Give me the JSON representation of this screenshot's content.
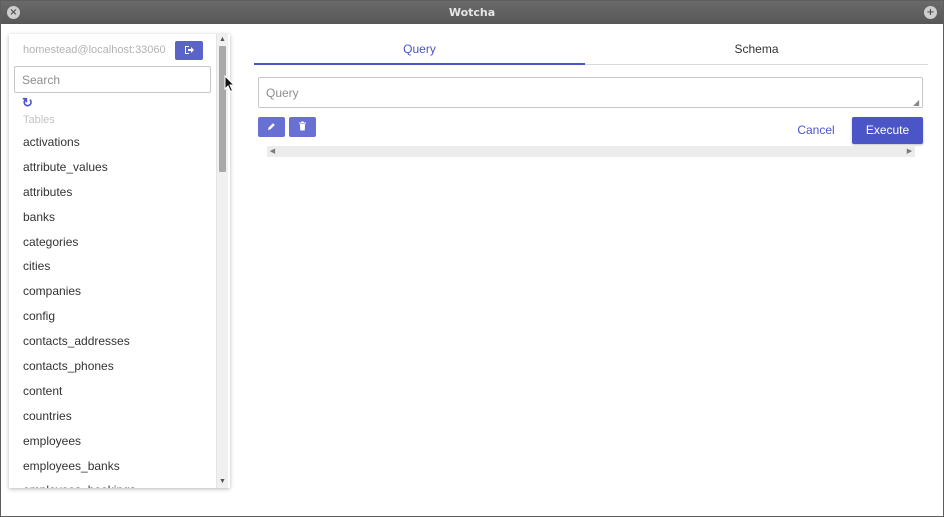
{
  "window": {
    "title": "Wotcha",
    "close_glyph": "×",
    "maximize_glyph": "+"
  },
  "sidebar": {
    "connection": "homestead@localhost:33060",
    "disconnect_icon": "sign-out-icon",
    "search_placeholder": "Search",
    "refresh_icon": "refresh-icon",
    "tables_heading": "Tables",
    "tables": [
      "activations",
      "attribute_values",
      "attributes",
      "banks",
      "categories",
      "cities",
      "companies",
      "config",
      "contacts_addresses",
      "contacts_phones",
      "content",
      "countries",
      "employees",
      "employees_banks",
      "employees_bookings"
    ]
  },
  "tabs": [
    "Query",
    "Schema"
  ],
  "active_tab": "Query",
  "query": {
    "placeholder": "Query",
    "edit_icon": "pencil-icon",
    "clear_icon": "trash-icon",
    "cancel_label": "Cancel",
    "execute_label": "Execute"
  },
  "colors": {
    "accent": "#4b55c6",
    "titlebar": "#5d5d5d"
  }
}
